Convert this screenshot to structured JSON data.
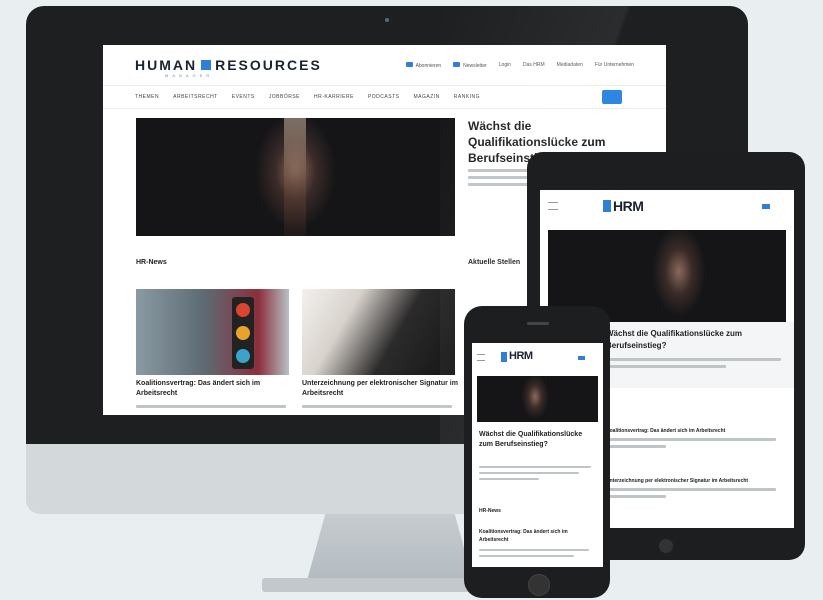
{
  "desktop": {
    "logo_text": "HUMAN",
    "logo_text2": "RESOURCES",
    "logo_sub": "MANAGER",
    "top_links": [
      "Abonnieren",
      "Newsletter",
      "Login",
      "Das HRM",
      "Mediadaten",
      "Für Unternehmen"
    ],
    "nav_items": [
      "THEMEN",
      "ARBEITSRECHT",
      "EVENTS",
      "JOBBÖRSE",
      "HR-KARRIERE",
      "PODCASTS",
      "MAGAZIN",
      "RANKING"
    ],
    "hero_title": "Wächst die Qualifikationslücke zum Berufseinstieg?",
    "section_hr": "HR-News",
    "section_aktuell": "Aktuelle Stellen",
    "cards": [
      {
        "title": "Koalitionsvertrag: Das ändert sich im Arbeitsrecht"
      },
      {
        "title": "Unterzeichnung per elektronischer Signatur im Arbeitsrecht"
      }
    ]
  },
  "tablet": {
    "logo": "HRM",
    "hero_title": "Wächst die Qualifikationslücke zum Berufseinstieg?",
    "item1": "Koalitionsvertrag: Das ändert sich im Arbeitsrecht",
    "item2": "Unterzeichnung per elektronischer Signatur im Arbeitsrecht"
  },
  "phone": {
    "logo": "HRM",
    "hero_title": "Wächst die Qualifikationslücke zum Berufseinstieg?",
    "section_hr": "HR-News",
    "card_title": "Koalitionsvertrag: Das ändert sich im Arbeitsrecht"
  },
  "colors": {
    "accent": "#2f86e0",
    "device": "#1e1f21",
    "background": "#e9eff1"
  }
}
